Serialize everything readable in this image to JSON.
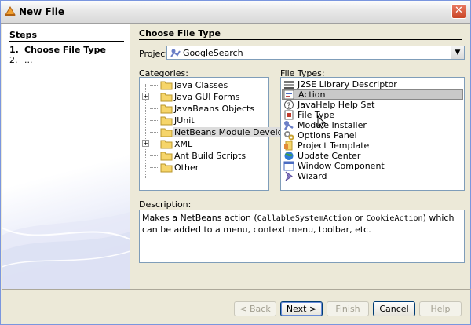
{
  "window": {
    "title": "New File",
    "close_glyph": "✕"
  },
  "steps": {
    "title": "Steps",
    "items": [
      {
        "num": "1.",
        "label": "Choose File Type"
      },
      {
        "num": "2.",
        "label": "..."
      }
    ]
  },
  "content": {
    "title": "Choose File Type",
    "project_label": "Project:",
    "project_value": "GoogleSearch",
    "categories_label": "Categories:",
    "filetypes_label": "File Types:",
    "categories": [
      {
        "label": "Java Classes",
        "expandable": false
      },
      {
        "label": "Java GUI Forms",
        "expandable": true
      },
      {
        "label": "JavaBeans Objects",
        "expandable": false
      },
      {
        "label": "JUnit",
        "expandable": false
      },
      {
        "label": "NetBeans Module Development",
        "expandable": false,
        "selected": true
      },
      {
        "label": "XML",
        "expandable": true
      },
      {
        "label": "Ant Build Scripts",
        "expandable": false
      },
      {
        "label": "Other",
        "expandable": false
      }
    ],
    "filetypes": [
      {
        "label": "J2SE Library Descriptor",
        "icon": "library-icon"
      },
      {
        "label": "Action",
        "icon": "action-icon",
        "selected": true
      },
      {
        "label": "JavaHelp Help Set",
        "icon": "help-icon"
      },
      {
        "label": "File Type",
        "icon": "file-type-icon"
      },
      {
        "label": "Module Installer",
        "icon": "module-installer-icon"
      },
      {
        "label": "Options Panel",
        "icon": "options-panel-icon"
      },
      {
        "label": "Project Template",
        "icon": "project-template-icon"
      },
      {
        "label": "Update Center",
        "icon": "update-center-icon"
      },
      {
        "label": "Window Component",
        "icon": "window-component-icon"
      },
      {
        "label": "Wizard",
        "icon": "wizard-icon"
      }
    ],
    "description_label": "Description:",
    "description": {
      "part1": "Makes a NetBeans action (",
      "code1": "CallableSystemAction",
      "part2": " or ",
      "code2": "CookieAction",
      "part3": ") which can be added to a menu, context menu, toolbar, etc."
    }
  },
  "buttons": {
    "back": "< Back",
    "next": "Next >",
    "finish": "Finish",
    "cancel": "Cancel",
    "help": "Help"
  }
}
